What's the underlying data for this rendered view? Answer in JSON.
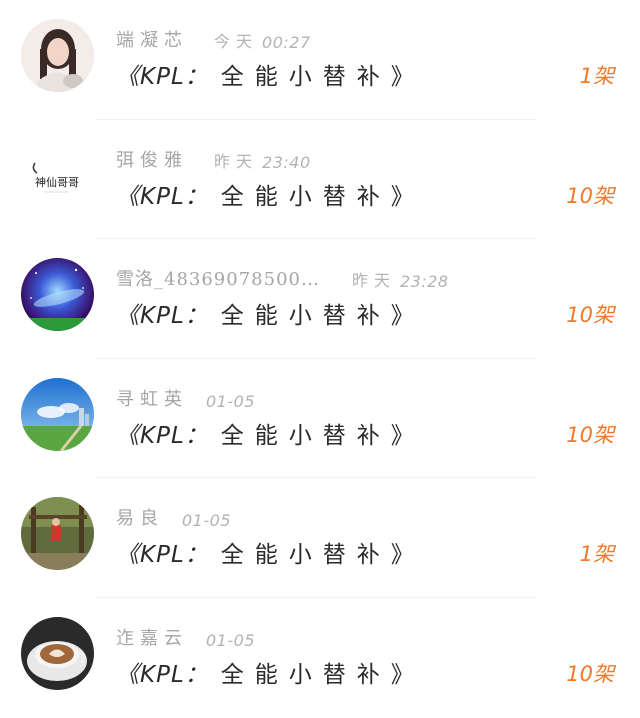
{
  "entries": [
    {
      "name": "端凝芯",
      "date": "今天",
      "time": "00:27",
      "title_prefix": "《KPL：",
      "title_main": "全能小替补",
      "title_suffix": "》",
      "count": "1架",
      "avatar": "portrait-girl"
    },
    {
      "name": "弭俊雅",
      "date": "昨天",
      "time": "23:40",
      "title_prefix": "《KPL：",
      "title_main": "全能小替补",
      "title_suffix": "》",
      "count": "10架",
      "avatar": "calligraphy-shenxiangege",
      "avatar_text": "神仙哥哥"
    },
    {
      "name": "雪洛_48369078500…",
      "date": "昨天",
      "time": "23:28",
      "title_prefix": "《KPL：",
      "title_main": "全能小替补",
      "title_suffix": "》",
      "count": "10架",
      "avatar": "galaxy"
    },
    {
      "name": "寻虹英",
      "date": "",
      "time": "01-05",
      "title_prefix": "《KPL：",
      "title_main": "全能小替补",
      "title_suffix": "》",
      "count": "10架",
      "avatar": "sky-landscape"
    },
    {
      "name": "易良",
      "date": "",
      "time": "01-05",
      "title_prefix": "《KPL：",
      "title_main": "全能小替补",
      "title_suffix": "》",
      "count": "1架",
      "avatar": "forest-swing"
    },
    {
      "name": "迮嘉云",
      "date": "",
      "time": "01-05",
      "title_prefix": "《KPL：",
      "title_main": "全能小替补",
      "title_suffix": "》",
      "count": "10架",
      "avatar": "coffee-cup"
    }
  ],
  "colors": {
    "count": "#f07a2a",
    "meta": "#a6a6a6",
    "title": "#2b2b2b"
  }
}
